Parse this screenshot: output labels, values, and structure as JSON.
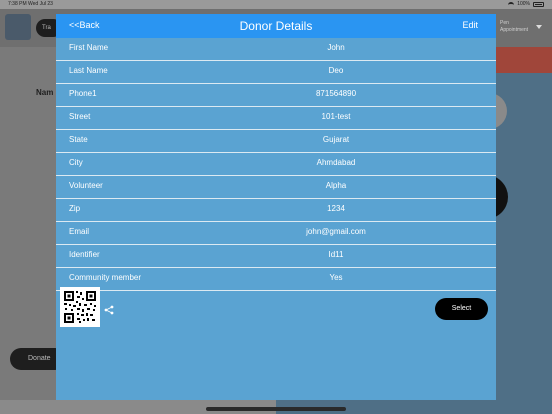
{
  "status_bar": {
    "time": "7:38 PM  Wed Jul 23",
    "battery": "100%"
  },
  "background": {
    "pill_label": "Tra",
    "left_label": "Nam",
    "donate_label": "Donate",
    "right_text_line1": "Pen",
    "right_text_line2": "Appointment"
  },
  "modal": {
    "back_label": "<<Back",
    "title": "Donor Details",
    "edit_label": "Edit",
    "fields": [
      {
        "label": "First Name",
        "value": "John"
      },
      {
        "label": "Last Name",
        "value": "Deo"
      },
      {
        "label": "Phone1",
        "value": "871564890"
      },
      {
        "label": "Street",
        "value": "101-test"
      },
      {
        "label": "State",
        "value": "Gujarat"
      },
      {
        "label": "City",
        "value": "Ahmdabad"
      },
      {
        "label": "Volunteer",
        "value": "Alpha"
      },
      {
        "label": "Zip",
        "value": "1234"
      },
      {
        "label": "Email",
        "value": "john@gmail.com"
      },
      {
        "label": "Identifier",
        "value": "Id11"
      },
      {
        "label": "Community member",
        "value": "Yes"
      }
    ],
    "select_label": "Select",
    "icons": {
      "qr": "qr-code-icon",
      "share": "share-icon"
    }
  },
  "colors": {
    "header": "#2a95f2",
    "modal_body": "#5aa3d2",
    "select_button": "#000000"
  }
}
